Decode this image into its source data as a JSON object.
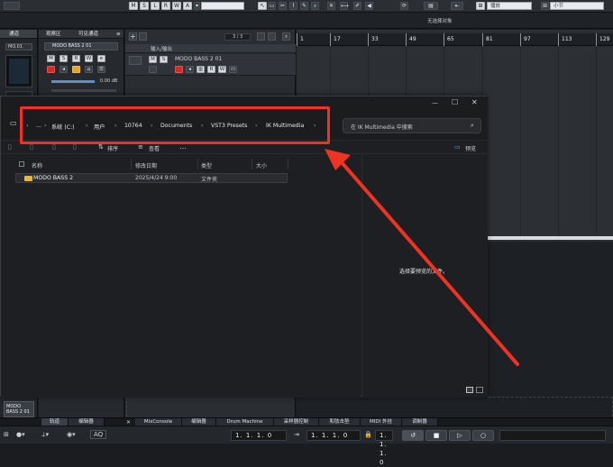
{
  "toolbar": {
    "buttons": [
      "M",
      "S",
      "L",
      "R",
      "W",
      "A"
    ],
    "quantize_select": "播放",
    "grid_select": "小节",
    "no_selection": "无选择对象"
  },
  "inspector": {
    "tab": "通道",
    "channel_name": "MO.01",
    "bottom_track": "MODO BASS 2 01"
  },
  "tracklist_panel": {
    "tab_visibility": "观察区",
    "tab_visible_channels": "可见通道",
    "track_name": "MODO BASS 2 01",
    "volume_readout": "0.00 dB"
  },
  "tracks": {
    "counter": "3 / 3",
    "io_track": "输入/输出",
    "midi_track": "MODO BASS 2 01"
  },
  "ruler": {
    "bars": [
      "1",
      "17",
      "33",
      "49",
      "65",
      "81",
      "97",
      "113",
      "129"
    ]
  },
  "dialog": {
    "breadcrumbs": [
      "…",
      "系统 (C:)",
      "用户",
      "10764",
      "Documents",
      "VST3 Presets",
      "IK Multimedia"
    ],
    "search_placeholder": "在 IK Multimedia 中搜索",
    "sort_label": "排序",
    "view_label": "查看",
    "more_label": "…",
    "preview_label": "预览",
    "columns": [
      "名称",
      "修改日期",
      "类型",
      "大小"
    ],
    "rows": [
      {
        "name": "MODO BASS 2",
        "modified": "2025/4/24 9:00",
        "type": "文件夹",
        "size": ""
      }
    ],
    "preview_message": "选择要预览的文件。"
  },
  "bottom_tabs": [
    "轨道",
    "编辑器",
    "MixConsole",
    "编辑器",
    "Drum Machine",
    "采样器控制",
    "和弦击垫",
    "MIDI 外挂",
    "调制器"
  ],
  "transport": {
    "left_position": "1. 1. 1. 0",
    "locator_left": "1. 1. 1. 0",
    "locator_right": "1. 1. 1. 0",
    "aq_label": "AQ"
  },
  "colors": {
    "highlight": "#ee3322",
    "record": "#d42b2b",
    "folder": "#e8b73a"
  }
}
